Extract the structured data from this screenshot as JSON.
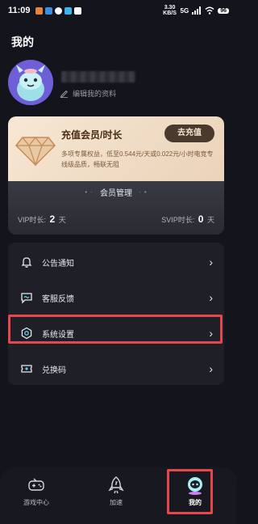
{
  "status_bar": {
    "time": "11:09",
    "network_speed": "3.30 KB/S",
    "network_label": "5G",
    "battery": "96"
  },
  "page": {
    "title": "我的"
  },
  "profile": {
    "edit_label": "编辑我的资料",
    "avatar_icon": "robot-avatar-icon"
  },
  "vip_card": {
    "title": "充值会员/时长",
    "description": "多项专属权益，低至0.544元/天或0.022元/小时电竞专线级品质，畅联无阻",
    "recharge_button": "去充值",
    "manage_label": "会员管理",
    "vip_label": "VIP时长:",
    "vip_days": "2",
    "svip_label": "SVIP时长:",
    "svip_days": "0",
    "unit": "天"
  },
  "menu": {
    "items": [
      {
        "label": "公告通知",
        "icon": "bell-icon"
      },
      {
        "label": "客服反馈",
        "icon": "chat-icon"
      },
      {
        "label": "系统设置",
        "icon": "settings-icon"
      },
      {
        "label": "兑换码",
        "icon": "ticket-icon"
      }
    ]
  },
  "bottom_nav": {
    "items": [
      {
        "label": "游戏中心",
        "icon": "gamepad-icon"
      },
      {
        "label": "加速",
        "icon": "rocket-icon"
      },
      {
        "label": "我的",
        "icon": "profile-mascot-icon"
      }
    ]
  },
  "colors": {
    "background": "#14141c",
    "highlight": "#e8464d",
    "vip_gold": "#f7e7d4"
  }
}
